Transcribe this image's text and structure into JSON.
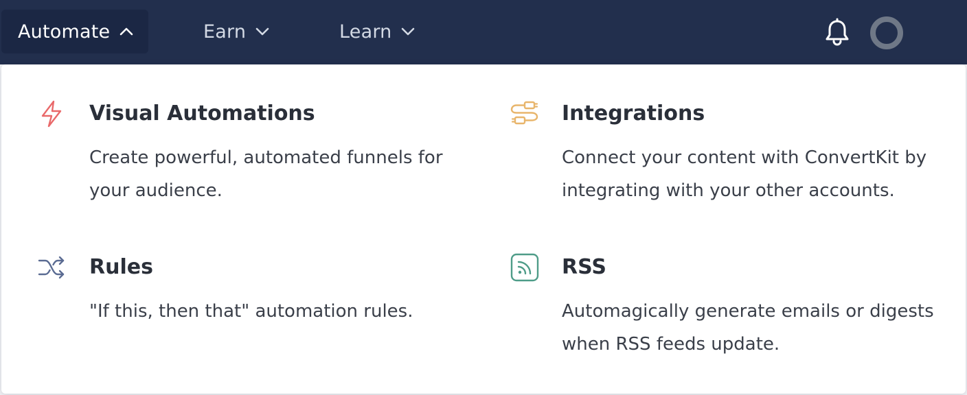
{
  "nav": {
    "items": [
      {
        "label": "Automate",
        "state": "open",
        "chevron": "chevron-up-icon"
      },
      {
        "label": "Earn",
        "state": "closed",
        "chevron": "chevron-down-icon"
      },
      {
        "label": "Learn",
        "state": "closed",
        "chevron": "chevron-down-icon"
      }
    ],
    "icons": [
      "bell-icon",
      "avatar"
    ]
  },
  "dropdown": {
    "items": [
      {
        "title": "Visual Automations",
        "description": "Create powerful, automated funnels for your audience.",
        "icon": "lightning-bolt-icon",
        "color": "#e9696a"
      },
      {
        "title": "Integrations",
        "description": "Connect your content with ConvertKit by integrating with your other accounts.",
        "icon": "plug-connector-icon",
        "color": "#e8b56b"
      },
      {
        "title": "Rules",
        "description": "\"If this, then that\" automation rules.",
        "icon": "shuffle-icon",
        "color": "#5a6b92"
      },
      {
        "title": "RSS",
        "description": "Automagically generate emails or digests when RSS feeds update.",
        "icon": "rss-icon",
        "color": "#4e9c88"
      }
    ]
  },
  "colors": {
    "topbar": "#222f4d",
    "active_nav": "#1b2744",
    "dropdown_bg": "#ffffff"
  }
}
